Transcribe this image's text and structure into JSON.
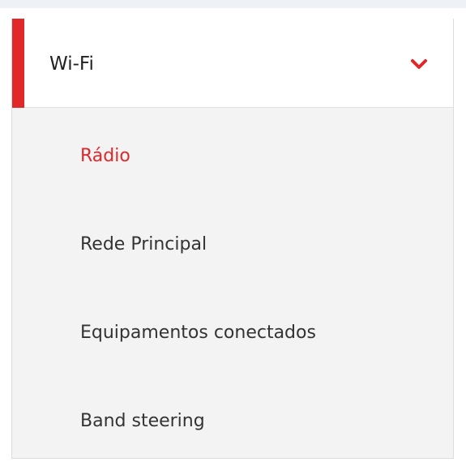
{
  "menu": {
    "header": {
      "label": "Wi-Fi",
      "icon": "chevron-down-icon",
      "accent_color": "#e0282a"
    },
    "items": [
      {
        "label": "Rádio",
        "active": true
      },
      {
        "label": "Rede Principal",
        "active": false
      },
      {
        "label": "Equipamentos conectados",
        "active": false
      },
      {
        "label": "Band steering",
        "active": false
      }
    ]
  }
}
